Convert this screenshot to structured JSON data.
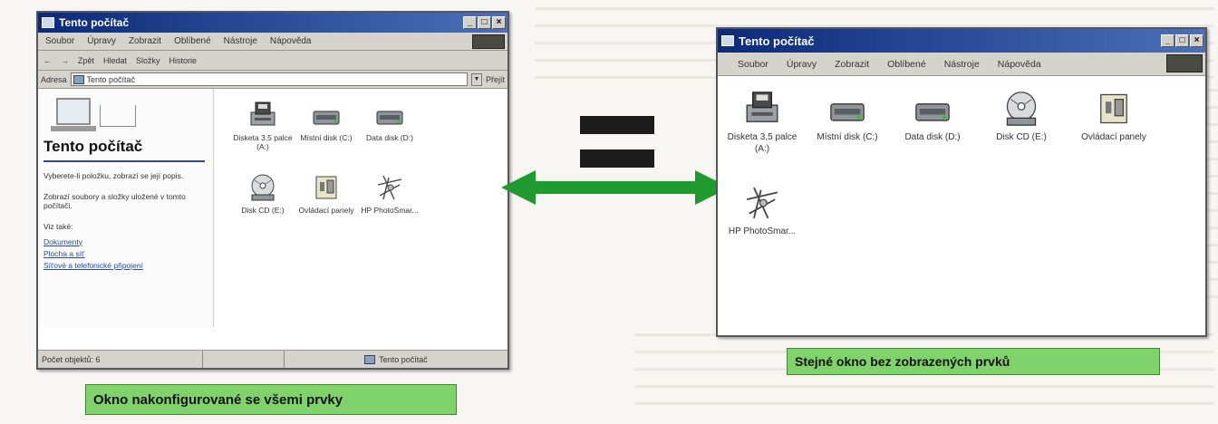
{
  "left_window": {
    "title": "Tento počítač",
    "controls": [
      "_",
      "□",
      "×"
    ],
    "menu": [
      "Soubor",
      "Úpravy",
      "Zobrazit",
      "Oblíbené",
      "Nástroje",
      "Nápověda"
    ],
    "toolbar": [
      "←",
      "→",
      "Zpět",
      "Hledat",
      "Složky",
      "Historie"
    ],
    "address_label": "Adresa",
    "address_value": "Tento počítač",
    "go_label": "Přejít",
    "panel_title": "Tento počítač",
    "panel_text1": "Vyberete-li položku, zobrazí se její popis.",
    "panel_text2": "Zobrazí soubory a složky uložené v tomto počítači.",
    "see_also_label": "Viz také:",
    "see_also_links": [
      "Dokumenty",
      "Plocha a síť",
      "Síťové a telefonické připojení"
    ],
    "status_left": "Počet objektů: 6",
    "status_right": "Tento počítač",
    "icons": [
      {
        "name": "floppy-drive-icon",
        "label": "Disketa 3,5 palce (A:)"
      },
      {
        "name": "local-disk-icon",
        "label": "Místní disk (C:)"
      },
      {
        "name": "data-disk-icon",
        "label": "Data disk (D:)"
      },
      {
        "name": "cd-drive-icon",
        "label": "Disk CD (E:)"
      },
      {
        "name": "control-panel-icon",
        "label": "Ovládací panely"
      },
      {
        "name": "hp-photosmart-icon",
        "label": "HP PhotoSmar..."
      }
    ]
  },
  "right_window": {
    "title": "Tento počítač",
    "controls": [
      "_",
      "□",
      "×"
    ],
    "menu": [
      "Soubor",
      "Úpravy",
      "Zobrazit",
      "Oblíbené",
      "Nástroje",
      "Nápověda"
    ],
    "icons": [
      {
        "name": "floppy-drive-icon",
        "label": "Disketa 3,5 palce (A:)"
      },
      {
        "name": "local-disk-icon",
        "label": "Místní disk (C:)"
      },
      {
        "name": "data-disk-icon",
        "label": "Data disk (D:)"
      },
      {
        "name": "cd-drive-icon",
        "label": "Disk CD (E:)"
      },
      {
        "name": "control-panel-icon",
        "label": "Ovládací panely"
      },
      {
        "name": "hp-photosmart-icon",
        "label": "HP PhotoSmar..."
      }
    ]
  },
  "captions": {
    "left": "Okno nakonfigurované se všemi prvky",
    "right": "Stejné okno bez zobrazených prvků"
  },
  "colors": {
    "caption_bg": "#7fd36a",
    "arrow": "#1f9a2e",
    "titlebar_start": "#0b2a7a",
    "titlebar_end": "#4b70b8"
  }
}
